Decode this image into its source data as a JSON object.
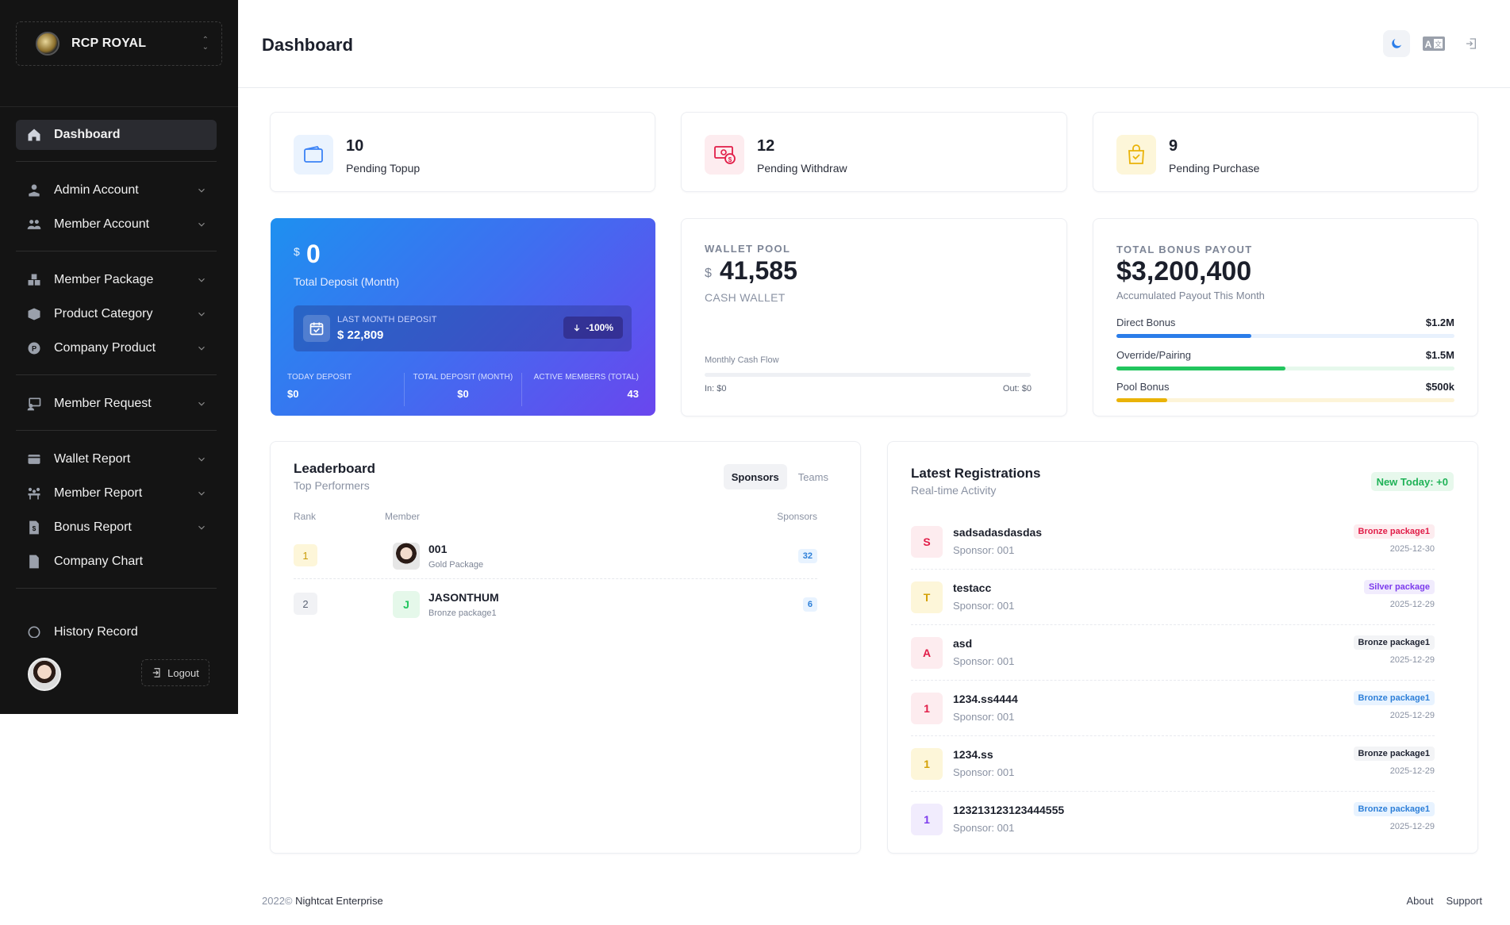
{
  "brand": {
    "name": "RCP ROYAL"
  },
  "sidebar": {
    "items": [
      {
        "label": "Dashboard",
        "icon": "home-icon"
      },
      {
        "label": "Admin Account",
        "icon": "admin-icon"
      },
      {
        "label": "Member Account",
        "icon": "users-icon"
      },
      {
        "label": "Member Package",
        "icon": "package-icon"
      },
      {
        "label": "Product Category",
        "icon": "box-icon"
      },
      {
        "label": "Company Product",
        "icon": "product-icon"
      },
      {
        "label": "Member Request",
        "icon": "request-icon"
      },
      {
        "label": "Wallet Report",
        "icon": "wallet-icon"
      },
      {
        "label": "Member Report",
        "icon": "team-icon"
      },
      {
        "label": "Bonus Report",
        "icon": "bonus-file-icon"
      },
      {
        "label": "Company Chart",
        "icon": "file-icon"
      },
      {
        "label": "History Record",
        "icon": "history-icon"
      }
    ],
    "logout_label": "Logout"
  },
  "header": {
    "title": "Dashboard"
  },
  "stats": [
    {
      "value": "10",
      "label": "Pending Topup",
      "color": "#3b82f6"
    },
    {
      "value": "12",
      "label": "Pending Withdraw",
      "color": "#e11d48"
    },
    {
      "value": "9",
      "label": "Pending Purchase",
      "color": "#eab308"
    }
  ],
  "deposit": {
    "currency": "$",
    "value": "0",
    "label": "Total Deposit (Month)",
    "last_month_label": "LAST MONTH DEPOSIT",
    "last_month_value": "$ 22,809",
    "change": "-100%",
    "footer": [
      {
        "key": "TODAY DEPOSIT",
        "value": "$0"
      },
      {
        "key": "TOTAL DEPOSIT (MONTH)",
        "value": "$0"
      },
      {
        "key": "ACTIVE MEMBERS (TOTAL)",
        "value": "43"
      }
    ]
  },
  "wallet": {
    "caption": "WALLET POOL",
    "currency": "$",
    "amount": "41,585",
    "type": "CASH WALLET",
    "flow_label": "Monthly Cash Flow",
    "in": "In: $0",
    "out": "Out: $0"
  },
  "bonus": {
    "caption": "TOTAL BONUS PAYOUT",
    "amount": "$3,200,400",
    "sub": "Accumulated Payout This Month",
    "rows": [
      {
        "name": "Direct Bonus",
        "value": "$1.2M",
        "fraction": 0.4,
        "color": "#2b7de9",
        "track": "#e8f1fd"
      },
      {
        "name": "Override/Pairing",
        "value": "$1.5M",
        "fraction": 0.5,
        "color": "#22c55e",
        "track": "#e6f8ec"
      },
      {
        "name": "Pool Bonus",
        "value": "$500k",
        "fraction": 0.15,
        "color": "#eab308",
        "track": "#fdf4d8"
      }
    ]
  },
  "leaderboard": {
    "title": "Leaderboard",
    "subtitle": "Top Performers",
    "tabs": [
      "Sponsors",
      "Teams"
    ],
    "columns": {
      "rank": "Rank",
      "member": "Member",
      "sponsors": "Sponsors"
    },
    "rows": [
      {
        "rank": "1",
        "name": "001",
        "package": "Gold Package",
        "count": "32",
        "avatar": "photo"
      },
      {
        "rank": "2",
        "name": "JASONTHUM",
        "package": "Bronze package1",
        "count": "6",
        "avatar": "J"
      }
    ]
  },
  "registrations": {
    "title": "Latest Registrations",
    "subtitle": "Real-time Activity",
    "badge": "New Today: +0",
    "rows": [
      {
        "initial": "S",
        "name": "sadsadasdasdas",
        "sponsor": "Sponsor: 001",
        "package": "Bronze package1",
        "date": "2025-12-30",
        "tone": "red",
        "pkg_tone": "red"
      },
      {
        "initial": "T",
        "name": "testacc",
        "sponsor": "Sponsor: 001",
        "package": "Silver package",
        "date": "2025-12-29",
        "tone": "yellow",
        "pkg_tone": "purple"
      },
      {
        "initial": "A",
        "name": "asd",
        "sponsor": "Sponsor: 001",
        "package": "Bronze package1",
        "date": "2025-12-29",
        "tone": "red",
        "pkg_tone": "gray"
      },
      {
        "initial": "1",
        "name": "1234.ss4444",
        "sponsor": "Sponsor: 001",
        "package": "Bronze package1",
        "date": "2025-12-29",
        "tone": "red",
        "pkg_tone": "blue"
      },
      {
        "initial": "1",
        "name": "1234.ss",
        "sponsor": "Sponsor: 001",
        "package": "Bronze package1",
        "date": "2025-12-29",
        "tone": "yellow",
        "pkg_tone": "gray"
      },
      {
        "initial": "1",
        "name": "123213123123444555",
        "sponsor": "Sponsor: 001",
        "package": "Bronze package1",
        "date": "2025-12-29",
        "tone": "purple",
        "pkg_tone": "blue"
      }
    ]
  },
  "footer": {
    "year": "2022©",
    "company": "Nightcat Enterprise",
    "links": [
      "About",
      "Support"
    ]
  }
}
